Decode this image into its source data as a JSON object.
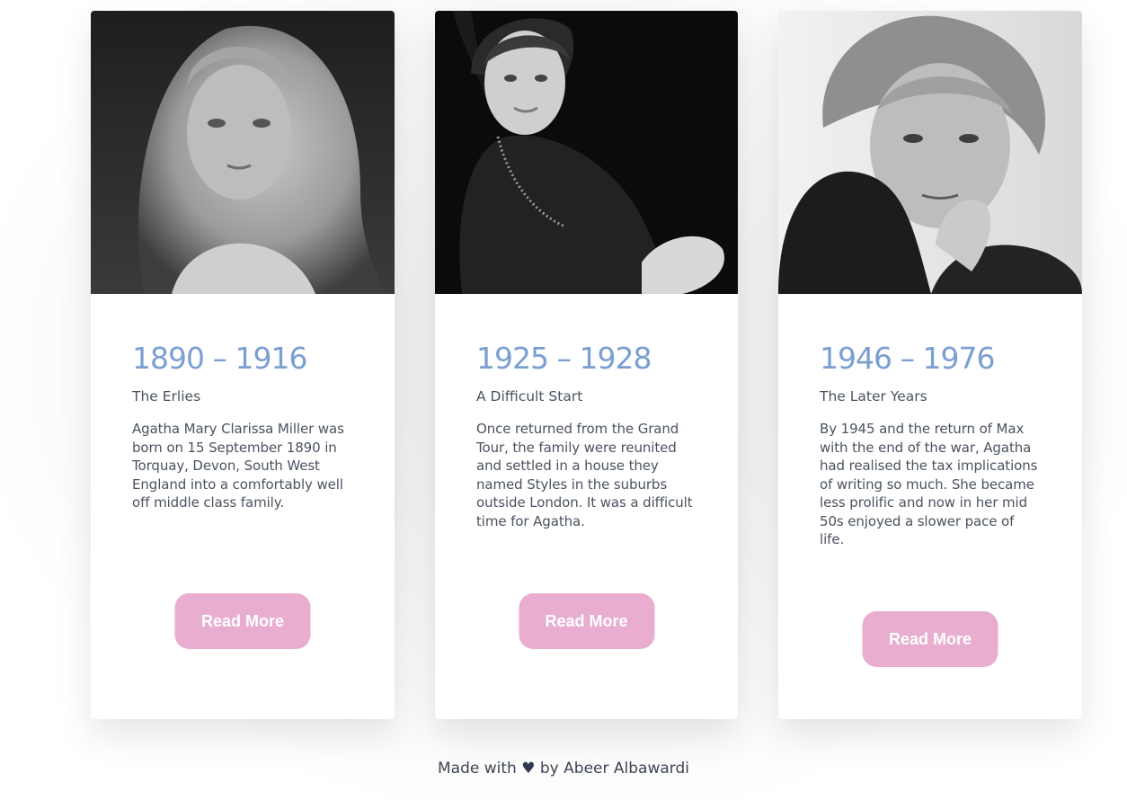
{
  "cards": [
    {
      "years": "1890 – 1916",
      "subtitle": "The Erlies",
      "description": "Agatha Mary Clarissa Miller was born on 15 September 1890 in Torquay, Devon, South West England into a comfortably well off middle class family.",
      "button_label": "Read More"
    },
    {
      "years": "1925 – 1928",
      "subtitle": "A Difficult Start",
      "description": "Once returned from the Grand Tour, the family were reunited and settled in a house they named Styles in the suburbs outside London. It was a difficult time for Agatha.",
      "button_label": "Read More"
    },
    {
      "years": "1946 – 1976",
      "subtitle": "The Later Years",
      "description": "By 1945 and the return of Max with the end of the war, Agatha had realised the tax implications of writing so much. She became less prolific and now in her mid 50s enjoyed a slower pace of life.",
      "button_label": "Read More"
    }
  ],
  "footer": {
    "prefix": "Made with",
    "heart": "♥",
    "suffix": "by Abeer Albawardi"
  },
  "colors": {
    "accent_years": "#7a9fd0",
    "button": "#e8adcf",
    "text": "#4b5260"
  }
}
